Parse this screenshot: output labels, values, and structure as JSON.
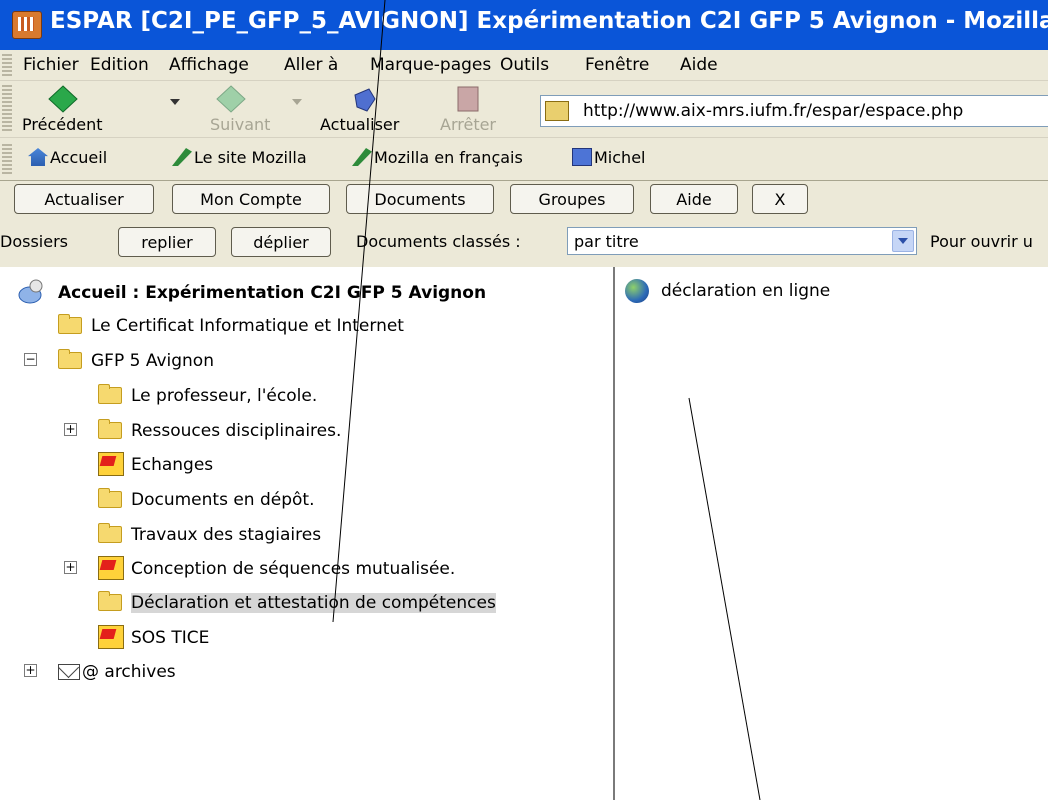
{
  "window": {
    "title": "ESPAR [C2I_PE_GFP_5_AVIGNON] Expérimentation C2I GFP 5 Avignon - Mozilla"
  },
  "menubar": {
    "items": [
      "Fichier",
      "Edition",
      "Affichage",
      "Aller à",
      "Marque-pages",
      "Outils",
      "Fenêtre",
      "Aide"
    ]
  },
  "toolbar": {
    "back": "Précédent",
    "forward": "Suivant",
    "reload": "Actualiser",
    "stop": "Arrêter",
    "url": "http://www.aix-mrs.iufm.fr/espar/espace.php"
  },
  "bookmarks": [
    "Accueil",
    "Le site Mozilla",
    "Mozilla en français",
    "Michel"
  ],
  "app_toolbar": {
    "buttons": [
      "Actualiser",
      "Mon Compte",
      "Documents",
      "Groupes",
      "Aide",
      "X"
    ]
  },
  "options_bar": {
    "folders_label": "Dossiers",
    "collapse": "replier",
    "expand": "déplier",
    "sort_label": "Documents classés :",
    "sort_value": "par titre",
    "open_hint": "Pour ouvrir u"
  },
  "tree": {
    "root": "Accueil : Expérimentation C2I GFP 5 Avignon",
    "items": [
      "Le Certificat Informatique et Internet",
      "GFP 5 Avignon",
      "Le professeur, l'école.",
      "Ressouces disciplinaires.",
      "Echanges",
      "Documents en dépôt.",
      "Travaux des stagiaires",
      "Conception de séquences mutualisée.",
      "Déclaration et attestation de compétences",
      "SOS TICE",
      "@ archives"
    ]
  },
  "documents": {
    "items": [
      "déclaration en ligne"
    ]
  },
  "colors": {
    "titlebar": "#0a55d8",
    "chrome": "#ece9d8",
    "selection": "#d6d6d6"
  }
}
